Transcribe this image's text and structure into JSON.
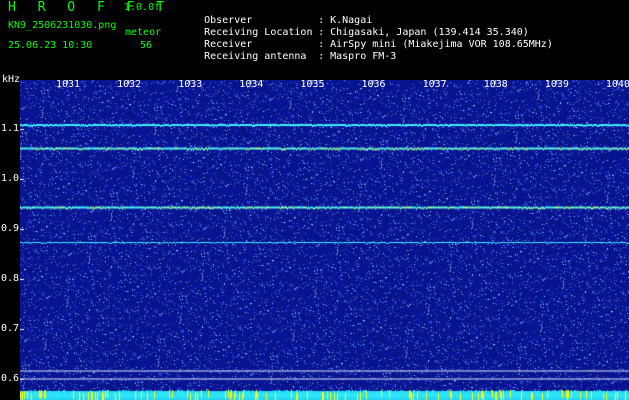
{
  "header": {
    "app_title": "H R O F F T",
    "version": "1.0.0f",
    "file_name": "KN9_2506231030.png",
    "meteor_label": "meteor",
    "date_time": "25.06.23 10:30",
    "meteor_count": "56",
    "info": [
      {
        "key": "Observer",
        "value": "K.Nagai"
      },
      {
        "key": "Receiving Location",
        "value": "Chigasaki, Japan (139.414 35.340)"
      },
      {
        "key": "Receiver",
        "value": "AirSpy mini (Miakejima VOR 108.65MHz)"
      },
      {
        "key": "Receiving antenna",
        "value": "Maspro FM-3"
      }
    ],
    "sep": ":"
  },
  "spectrogram": {
    "y_unit": "kHz",
    "y_ticks": [
      "1.1",
      "1.0",
      "0.9",
      "0.8",
      "0.7",
      "0.6"
    ],
    "x_ticks": [
      "1031",
      "1032",
      "1033",
      "1034",
      "1035",
      "1036",
      "1037",
      "1038",
      "1039",
      "1040"
    ],
    "background_color": "#0b1f8a",
    "carrier_color": "#3cf0ff"
  },
  "chart_data": {
    "type": "heatmap",
    "xlabel": "",
    "ylabel": "kHz",
    "x_tick_labels": [
      "1031",
      "1032",
      "1033",
      "1034",
      "1035",
      "1036",
      "1037",
      "1038",
      "1039",
      "1040"
    ],
    "y_tick_labels": [
      "1.1",
      "1.0",
      "0.9",
      "0.8",
      "0.7",
      "0.6"
    ],
    "ylim": [
      0.58,
      1.16
    ],
    "carrier_lines_khz": [
      1.11,
      1.063,
      0.945,
      0.874
    ],
    "white_lines_khz": [
      0.617,
      0.601
    ],
    "grid": false
  }
}
